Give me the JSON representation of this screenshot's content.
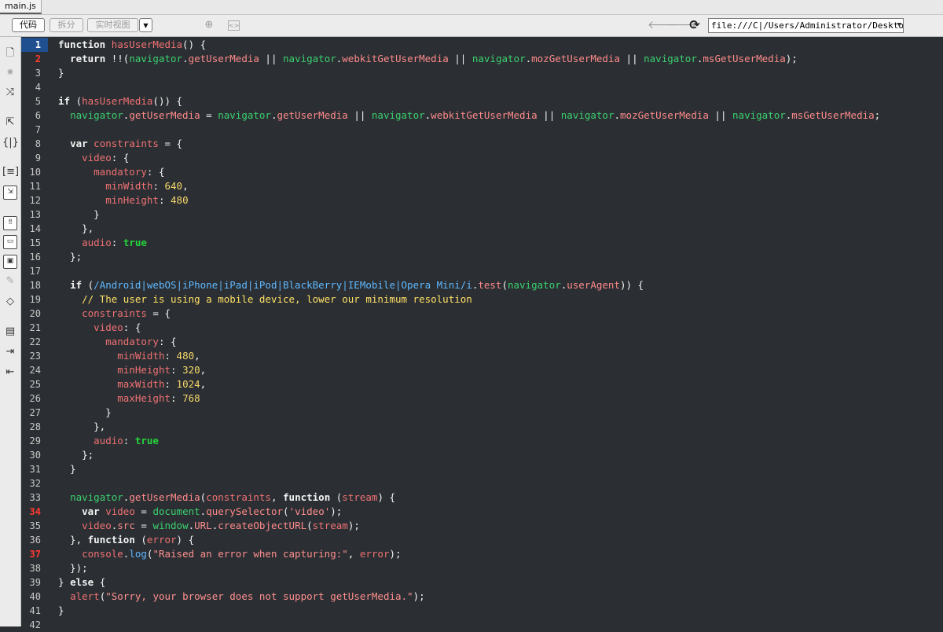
{
  "tab": {
    "label": "main.js"
  },
  "toolbar": {
    "code_label": "代码",
    "split_label": "拆分",
    "live_label": "实时视图",
    "url": "file:///C|/Users/Administrator/Desktop"
  },
  "gutter": {
    "current_line": 1,
    "error_lines": [
      2,
      34,
      37
    ],
    "line_count": 42
  },
  "code_lines": [
    [
      [
        "kw",
        "function "
      ],
      [
        "fn",
        "hasUserMedia"
      ],
      [
        "def",
        "() {"
      ]
    ],
    [
      [
        "def",
        "  "
      ],
      [
        "kw",
        "return "
      ],
      [
        "def",
        "!!("
      ],
      [
        "nav",
        "navigator"
      ],
      [
        "def",
        "."
      ],
      [
        "prop",
        "getUserMedia"
      ],
      [
        "def",
        " || "
      ],
      [
        "nav",
        "navigator"
      ],
      [
        "def",
        "."
      ],
      [
        "prop",
        "webkitGetUserMedia"
      ],
      [
        "def",
        " || "
      ],
      [
        "nav",
        "navigator"
      ],
      [
        "def",
        "."
      ],
      [
        "prop",
        "mozGetUserMedia"
      ],
      [
        "def",
        " || "
      ],
      [
        "nav",
        "navigator"
      ],
      [
        "def",
        "."
      ],
      [
        "prop",
        "msGetUserMedia"
      ],
      [
        "def",
        ");"
      ]
    ],
    [
      [
        "def",
        "}"
      ]
    ],
    [
      [
        "def",
        ""
      ]
    ],
    [
      [
        "kw",
        "if "
      ],
      [
        "def",
        "("
      ],
      [
        "fn",
        "hasUserMedia"
      ],
      [
        "def",
        "()) {"
      ]
    ],
    [
      [
        "def",
        "  "
      ],
      [
        "nav",
        "navigator"
      ],
      [
        "def",
        "."
      ],
      [
        "prop",
        "getUserMedia"
      ],
      [
        "def",
        " = "
      ],
      [
        "nav",
        "navigator"
      ],
      [
        "def",
        "."
      ],
      [
        "prop",
        "getUserMedia"
      ],
      [
        "def",
        " || "
      ],
      [
        "nav",
        "navigator"
      ],
      [
        "def",
        "."
      ],
      [
        "prop",
        "webkitGetUserMedia"
      ],
      [
        "def",
        " || "
      ],
      [
        "nav",
        "navigator"
      ],
      [
        "def",
        "."
      ],
      [
        "prop",
        "mozGetUserMedia"
      ],
      [
        "def",
        " || "
      ],
      [
        "nav",
        "navigator"
      ],
      [
        "def",
        "."
      ],
      [
        "prop",
        "msGetUserMedia"
      ],
      [
        "def",
        ";"
      ]
    ],
    [
      [
        "def",
        ""
      ]
    ],
    [
      [
        "def",
        "  "
      ],
      [
        "kw",
        "var "
      ],
      [
        "fn",
        "constraints"
      ],
      [
        "def",
        " = {"
      ]
    ],
    [
      [
        "def",
        "    "
      ],
      [
        "fn",
        "video"
      ],
      [
        "def",
        ": {"
      ]
    ],
    [
      [
        "def",
        "      "
      ],
      [
        "fn",
        "mandatory"
      ],
      [
        "def",
        ": {"
      ]
    ],
    [
      [
        "def",
        "        "
      ],
      [
        "fn",
        "minWidth"
      ],
      [
        "def",
        ": "
      ],
      [
        "num",
        "640"
      ],
      [
        "def",
        ","
      ]
    ],
    [
      [
        "def",
        "        "
      ],
      [
        "fn",
        "minHeight"
      ],
      [
        "def",
        ": "
      ],
      [
        "num",
        "480"
      ]
    ],
    [
      [
        "def",
        "      }"
      ]
    ],
    [
      [
        "def",
        "    },"
      ]
    ],
    [
      [
        "def",
        "    "
      ],
      [
        "fn",
        "audio"
      ],
      [
        "def",
        ": "
      ],
      [
        "kwg",
        "true"
      ]
    ],
    [
      [
        "def",
        "  };"
      ]
    ],
    [
      [
        "def",
        ""
      ]
    ],
    [
      [
        "def",
        "  "
      ],
      [
        "kw",
        "if "
      ],
      [
        "def",
        "("
      ],
      [
        "re",
        "/Android|webOS|iPhone|iPad|iPod|BlackBerry|IEMobile|Opera Mini/i"
      ],
      [
        "def",
        "."
      ],
      [
        "prop",
        "test"
      ],
      [
        "def",
        "("
      ],
      [
        "nav",
        "navigator"
      ],
      [
        "def",
        "."
      ],
      [
        "prop",
        "userAgent"
      ],
      [
        "def",
        ")) {"
      ]
    ],
    [
      [
        "def",
        "    "
      ],
      [
        "cm",
        "// The user is using a mobile device, lower our minimum resolution"
      ]
    ],
    [
      [
        "def",
        "    "
      ],
      [
        "fn",
        "constraints"
      ],
      [
        "def",
        " = {"
      ]
    ],
    [
      [
        "def",
        "      "
      ],
      [
        "fn",
        "video"
      ],
      [
        "def",
        ": {"
      ]
    ],
    [
      [
        "def",
        "        "
      ],
      [
        "fn",
        "mandatory"
      ],
      [
        "def",
        ": {"
      ]
    ],
    [
      [
        "def",
        "          "
      ],
      [
        "fn",
        "minWidth"
      ],
      [
        "def",
        ": "
      ],
      [
        "num",
        "480"
      ],
      [
        "def",
        ","
      ]
    ],
    [
      [
        "def",
        "          "
      ],
      [
        "fn",
        "minHeight"
      ],
      [
        "def",
        ": "
      ],
      [
        "num",
        "320"
      ],
      [
        "def",
        ","
      ]
    ],
    [
      [
        "def",
        "          "
      ],
      [
        "fn",
        "maxWidth"
      ],
      [
        "def",
        ": "
      ],
      [
        "num",
        "1024"
      ],
      [
        "def",
        ","
      ]
    ],
    [
      [
        "def",
        "          "
      ],
      [
        "fn",
        "maxHeight"
      ],
      [
        "def",
        ": "
      ],
      [
        "num",
        "768"
      ]
    ],
    [
      [
        "def",
        "        }"
      ]
    ],
    [
      [
        "def",
        "      },"
      ]
    ],
    [
      [
        "def",
        "      "
      ],
      [
        "fn",
        "audio"
      ],
      [
        "def",
        ": "
      ],
      [
        "kwg",
        "true"
      ]
    ],
    [
      [
        "def",
        "    };"
      ]
    ],
    [
      [
        "def",
        "  }"
      ]
    ],
    [
      [
        "def",
        ""
      ]
    ],
    [
      [
        "def",
        "  "
      ],
      [
        "nav",
        "navigator"
      ],
      [
        "def",
        "."
      ],
      [
        "prop",
        "getUserMedia"
      ],
      [
        "def",
        "("
      ],
      [
        "fn",
        "constraints"
      ],
      [
        "def",
        ", "
      ],
      [
        "kw",
        "function "
      ],
      [
        "def",
        "("
      ],
      [
        "fn",
        "stream"
      ],
      [
        "def",
        ") {"
      ]
    ],
    [
      [
        "def",
        "    "
      ],
      [
        "kw",
        "var "
      ],
      [
        "fn",
        "video"
      ],
      [
        "def",
        " = "
      ],
      [
        "nav",
        "document"
      ],
      [
        "def",
        "."
      ],
      [
        "prop",
        "querySelector"
      ],
      [
        "def",
        "("
      ],
      [
        "str",
        "'video'"
      ],
      [
        "def",
        ");"
      ]
    ],
    [
      [
        "def",
        "    "
      ],
      [
        "fn",
        "video"
      ],
      [
        "def",
        "."
      ],
      [
        "prop",
        "src"
      ],
      [
        "def",
        " = "
      ],
      [
        "nav",
        "window"
      ],
      [
        "def",
        "."
      ],
      [
        "prop",
        "URL"
      ],
      [
        "def",
        "."
      ],
      [
        "prop",
        "createObjectURL"
      ],
      [
        "def",
        "("
      ],
      [
        "fn",
        "stream"
      ],
      [
        "def",
        ");"
      ]
    ],
    [
      [
        "def",
        "  }, "
      ],
      [
        "kw",
        "function "
      ],
      [
        "def",
        "("
      ],
      [
        "fn",
        "error"
      ],
      [
        "def",
        ") {"
      ]
    ],
    [
      [
        "def",
        "    "
      ],
      [
        "fn",
        "console"
      ],
      [
        "def",
        "."
      ],
      [
        "re",
        "log"
      ],
      [
        "def",
        "("
      ],
      [
        "str",
        "\"Raised an error when capturing:\""
      ],
      [
        "def",
        ", "
      ],
      [
        "fn",
        "error"
      ],
      [
        "def",
        ");"
      ]
    ],
    [
      [
        "def",
        "  });"
      ]
    ],
    [
      [
        "def",
        "} "
      ],
      [
        "kw",
        "else "
      ],
      [
        "def",
        "{"
      ]
    ],
    [
      [
        "def",
        "  "
      ],
      [
        "fn",
        "alert"
      ],
      [
        "def",
        "("
      ],
      [
        "str",
        "\"Sorry, your browser does not support getUserMedia.\""
      ],
      [
        "def",
        ");"
      ]
    ],
    [
      [
        "def",
        "}"
      ]
    ],
    [
      [
        "def",
        ""
      ]
    ]
  ],
  "sidebar_icons": [
    "open-documents-icon",
    "collapse-full-tag-icon",
    "collapse-selection-icon",
    "expand-all-icon",
    "select-parent-tag-icon",
    "balance-braces-icon",
    "line-numbers-icon",
    "wrap-text-icon",
    "apply-comment-icon",
    "remove-comment-icon",
    "wrap-tag-icon",
    "recent-snippets-icon",
    "move-css-icon",
    "indent-code-icon",
    "outdent-code-icon",
    "format-source-icon"
  ]
}
